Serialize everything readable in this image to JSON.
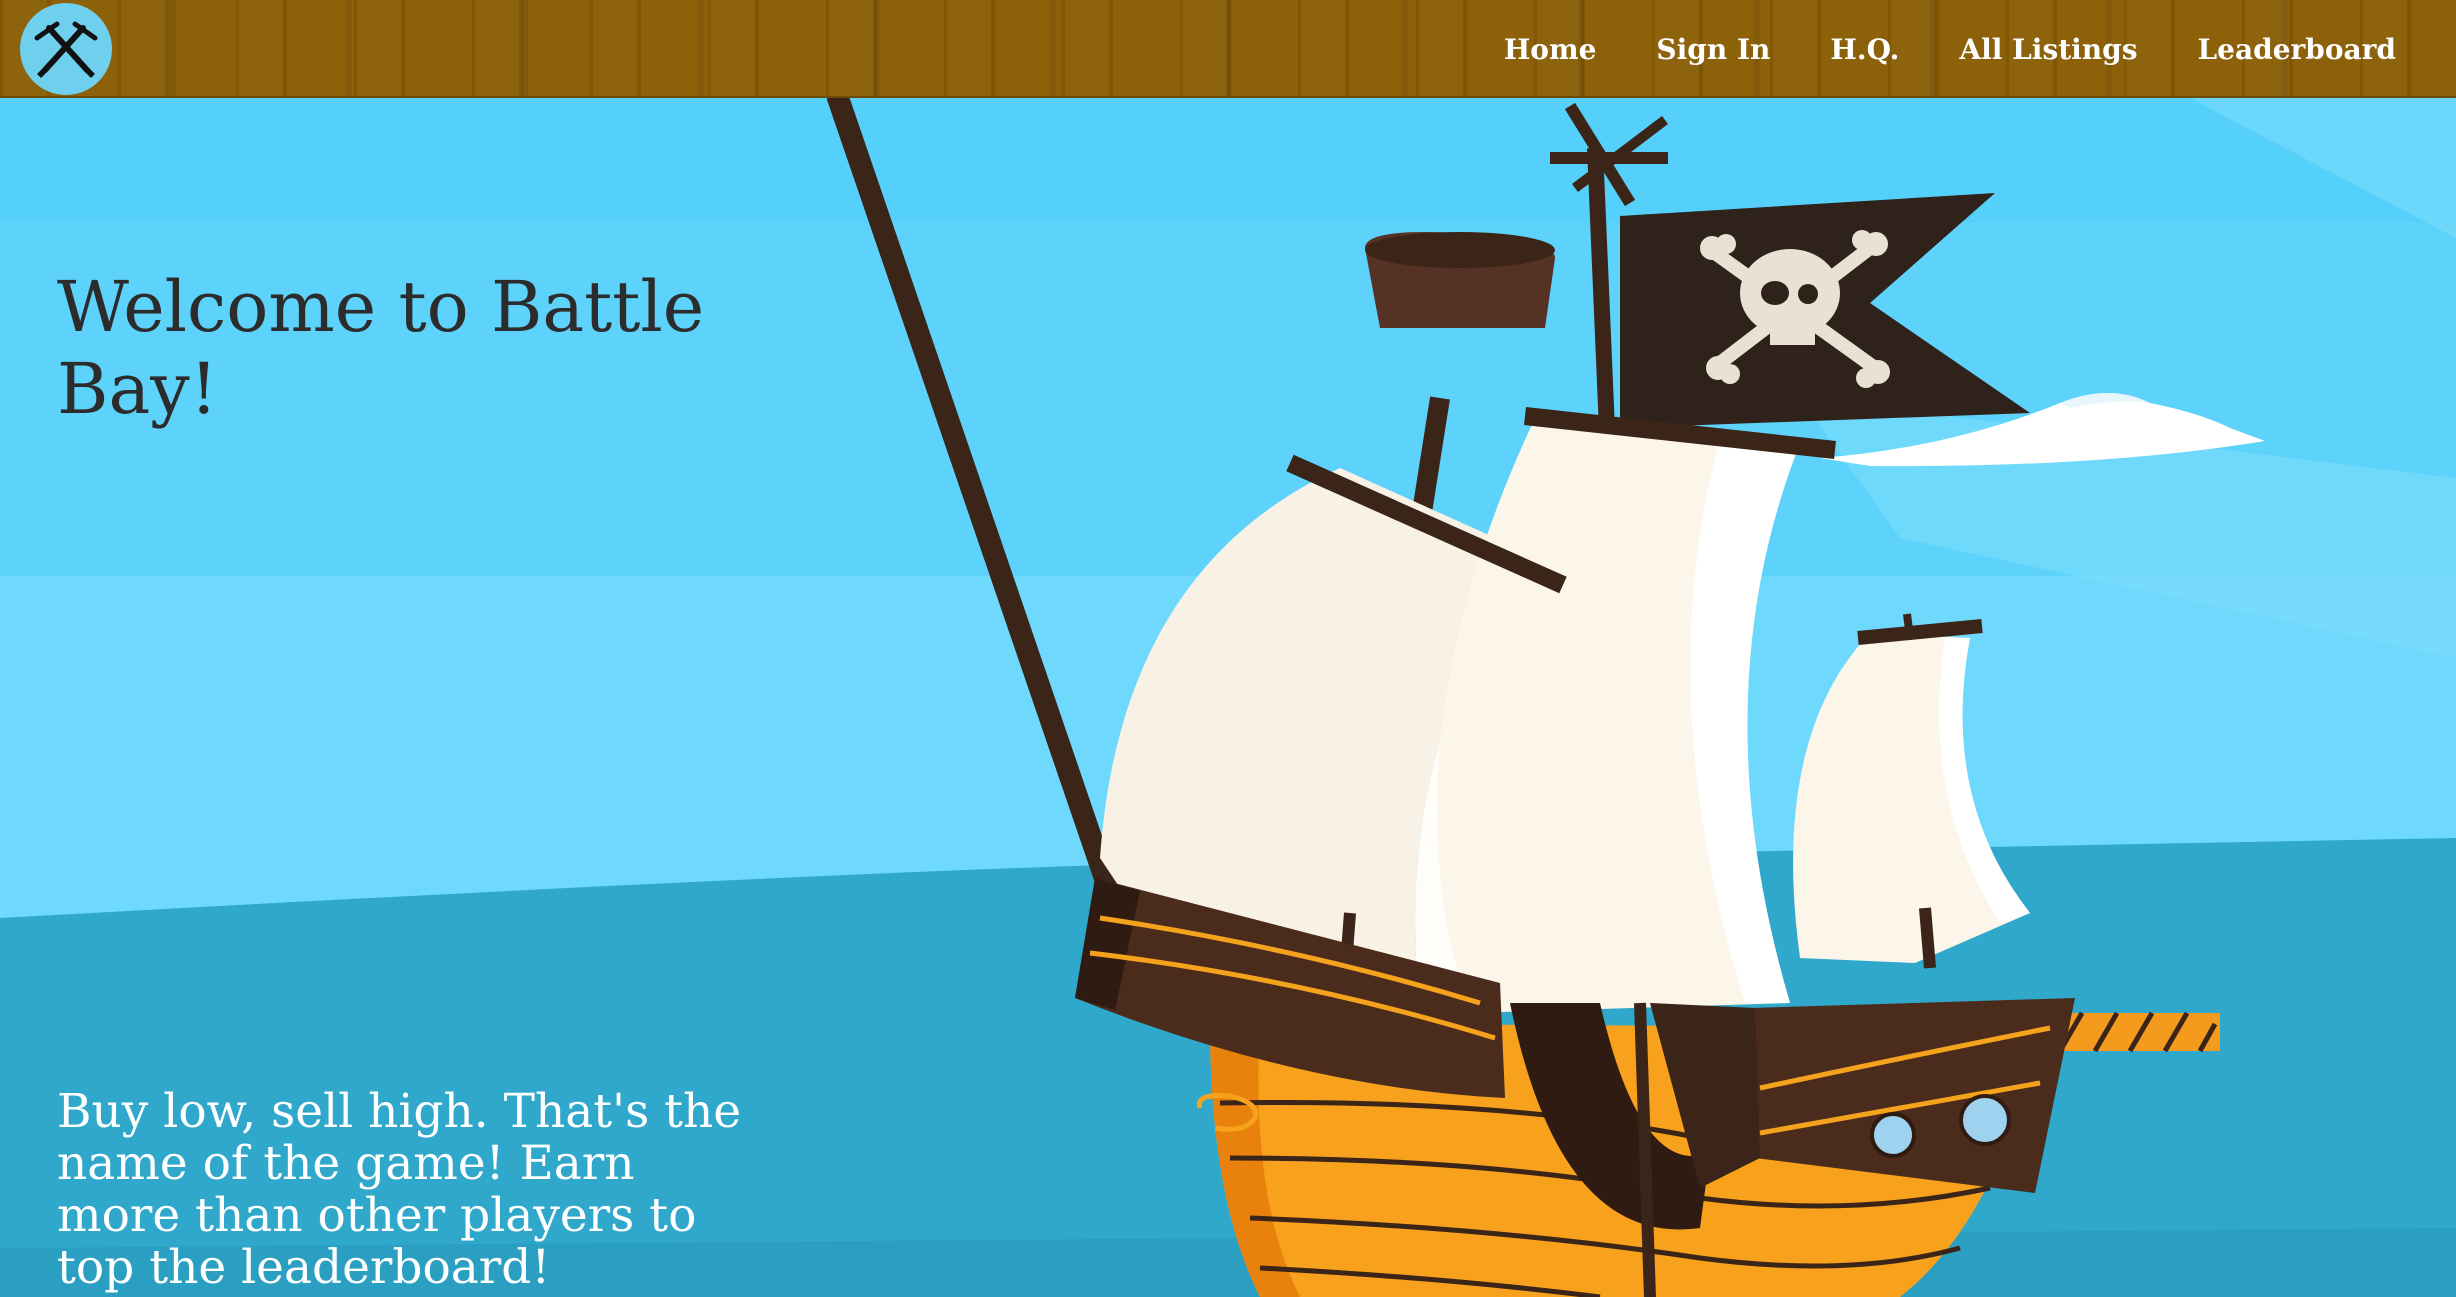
{
  "nav": {
    "logo_icon": "crossed-swords-icon",
    "links": [
      "Home",
      "Sign In",
      "H.Q.",
      "All Listings",
      "Leaderboard"
    ]
  },
  "hero": {
    "title": "Welcome to Battle Bay!",
    "tagline": "Buy low, sell high. That's the name of the game! Earn more than other players to top the leaderboard!",
    "illustration": "pirate-ship-illustration"
  },
  "colors": {
    "navbar": "#8a5e05",
    "sky": "#55d0fb",
    "sea": "#2fa8cc",
    "title_text": "#2c2c2c",
    "tagline_text": "#ffffff",
    "logo_circle": "#6fd0ee"
  }
}
